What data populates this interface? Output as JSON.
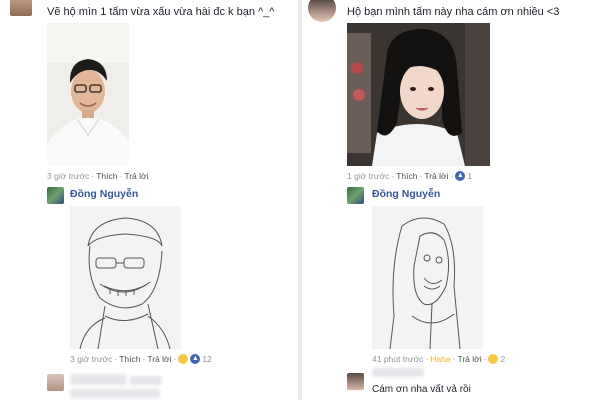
{
  "left": {
    "caption": "Vẽ hộ mìn 1 tấm vừa xấu vừa hài đc k bạn ^_^",
    "meta1": {
      "time": "3 giờ trước",
      "like": "Thích",
      "reply": "Trả lời"
    },
    "reply_name": "Đồng Nguyễn",
    "meta2": {
      "time": "3 giờ trước",
      "like": "Thích",
      "reply": "Trả lời",
      "count": "12"
    }
  },
  "right": {
    "caption": "Hộ bạn mình tấm này nha cám ơn nhiều <3",
    "meta1": {
      "time": "1 giờ trước",
      "like": "Thích",
      "reply": "Trả lời",
      "count": "1"
    },
    "reply_name": "Đồng Nguyễn",
    "meta2": {
      "time": "41 phút trước",
      "reaction": "Haha",
      "reply": "Trả lời",
      "count": "2"
    },
    "comment": "Cám ơn nha vất vả rồi"
  },
  "icons": {
    "like": "like-reaction-icon",
    "haha": "haha-reaction-icon"
  },
  "colors": {
    "name": "#365899",
    "meta": "#90949c",
    "haha": "#f7b125",
    "like": "#4267b2",
    "divider": "#e9ebee"
  }
}
